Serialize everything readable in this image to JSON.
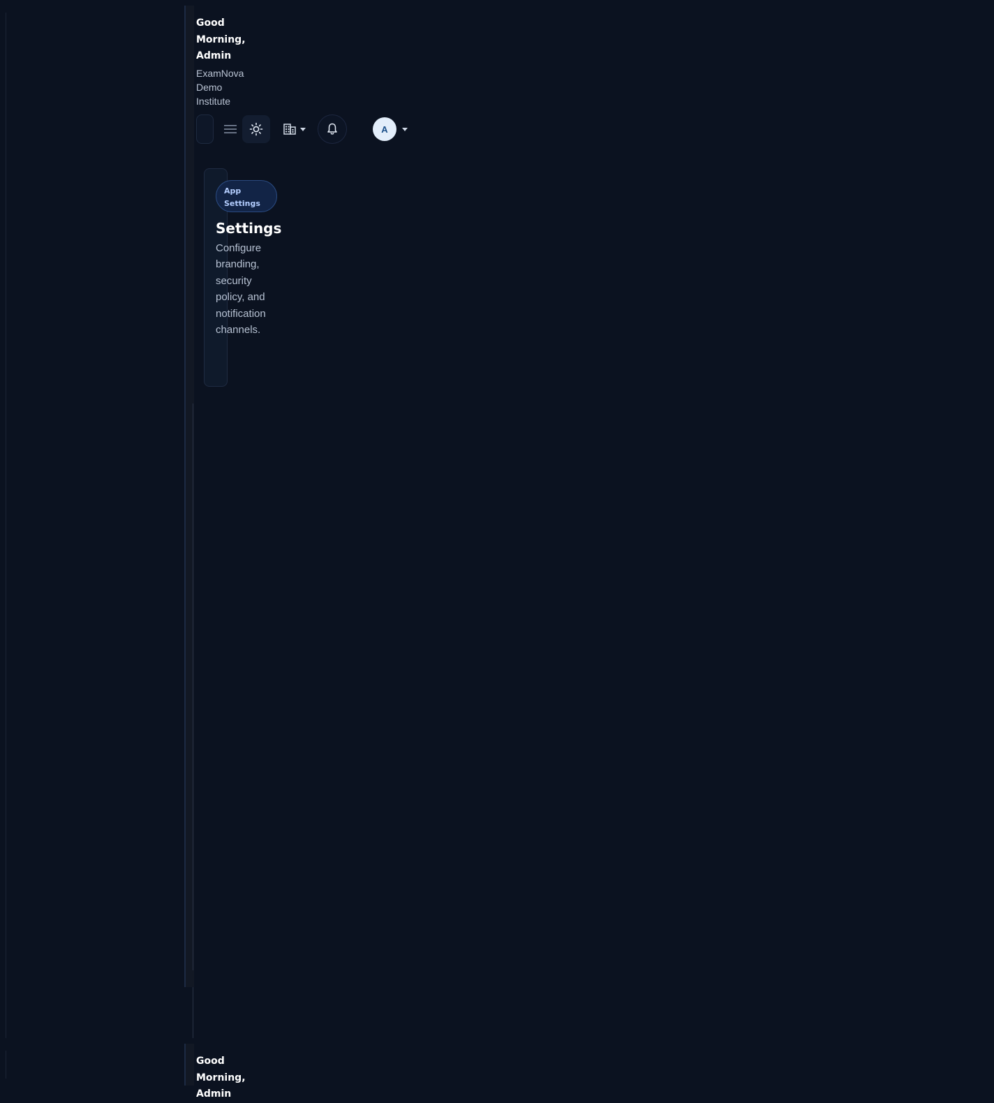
{
  "header": {
    "greeting": "Good Morning, Admin",
    "institute": "ExamNova Demo Institute"
  },
  "toolbar": {
    "search_icon": "search-field",
    "menu_icon": "hamburger-menu-icon",
    "theme_icon": "sun-icon",
    "org_icon": "building-icon",
    "notification_icon": "bell-icon",
    "avatar_initial": "A"
  },
  "card": {
    "badge": "App Settings",
    "title": "Settings",
    "description": "Configure branding, security policy, and notification channels."
  },
  "colors": {
    "background": "#0b1220",
    "accent": "#b4ceff",
    "avatar_bg": "#e3eefb"
  },
  "repeat_header": {
    "greeting": "Good Morning, Admin"
  }
}
